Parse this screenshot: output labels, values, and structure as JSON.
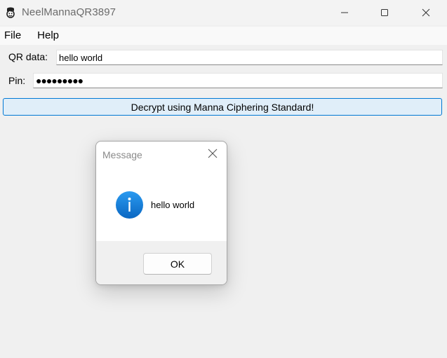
{
  "window": {
    "title": "NeelMannaQR3897",
    "icon": "app-icon"
  },
  "menubar": {
    "items": [
      {
        "label": "File"
      },
      {
        "label": "Help"
      }
    ]
  },
  "form": {
    "qr_label": "QR data:",
    "qr_value": "hello world",
    "pin_label": "Pin:",
    "pin_value": "●●●●●●●●●",
    "decrypt_label": "Decrypt using Manna Ciphering Standard!"
  },
  "dialog": {
    "title": "Message",
    "message": "hello world",
    "icon": "info-icon",
    "ok_label": "OK"
  },
  "colors": {
    "accent": "#0078d4",
    "button_bg": "#e0eef9",
    "background": "#f0f0f0"
  }
}
